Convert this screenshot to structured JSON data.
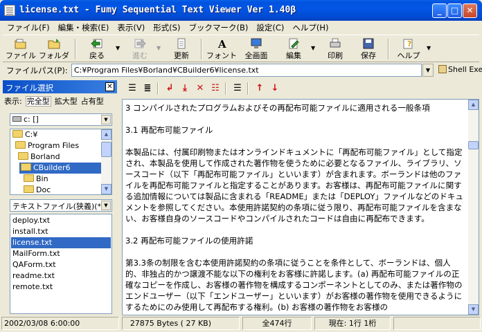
{
  "window": {
    "title": "license.txt - Fumy Sequential Text Viewer  Ver 1.40β",
    "minimize": "_",
    "maximize": "□",
    "close": "✕"
  },
  "menu": [
    "ファイル(F)",
    "編集・検索(E)",
    "表示(V)",
    "形式(S)",
    "ブックマーク(B)",
    "設定(C)",
    "ヘルプ(H)"
  ],
  "toolbar": {
    "file": "ファイル",
    "folder": "フォルダ",
    "back": "戻る",
    "forward": "進む",
    "refresh": "更新",
    "font": "フォント",
    "fullscreen": "全画面",
    "edit": "編集",
    "print": "印刷",
    "save": "保存",
    "help": "ヘルプ"
  },
  "pathbar": {
    "label": "ファイルパス(P):",
    "value": "C:¥Program Files¥Borland¥CBuilder6¥license.txt",
    "shell_button": "Shell Exec."
  },
  "left_panel": {
    "title": "ファイル選択",
    "view_label": "表示:",
    "view_options": [
      "完全型",
      "拡大型",
      "占有型"
    ],
    "drive": "c: []",
    "tree": [
      {
        "label": "C:¥",
        "selected": false
      },
      {
        "label": "Program Files",
        "selected": false
      },
      {
        "label": "Borland",
        "selected": false
      },
      {
        "label": "CBuilder6",
        "selected": true
      },
      {
        "label": "Bin",
        "selected": false
      },
      {
        "label": "Doc",
        "selected": false
      }
    ],
    "filter": "テキストファイル(狭義)(*",
    "files": [
      {
        "name": "deploy.txt",
        "selected": false
      },
      {
        "name": "install.txt",
        "selected": false
      },
      {
        "name": "license.txt",
        "selected": true
      },
      {
        "name": "MailForm.txt",
        "selected": false
      },
      {
        "name": "QAForm.txt",
        "selected": false
      },
      {
        "name": "readme.txt",
        "selected": false
      },
      {
        "name": "remote.txt",
        "selected": false
      }
    ]
  },
  "document": {
    "lines": [
      "3 コンパイルされたプログラムおよびその再配布可能ファイルに適用される一般条項",
      "",
      "3.1 再配布可能ファイル",
      "",
      "本製品には、付属印刷物またはオンラインドキュメントに「再配布可能ファイル」として指定され、本製品を使用して作成された著作物を使うために必要となるファイル、ライブラリ、ソースコード（以下「再配布可能ファイル」といいます）が含まれます。ボーランドは他のファイルを再配布可能ファイルと指定することがあります。お客様は、再配布可能ファイルに関する追加情報については製品に含まれる「README」または「DEPLOY」ファイルなどのドキュメントを参照してください。本使用許諾契約の条項に従う限り、再配布可能ファイルを含まない、お客様自身のソースコードやコンパイルされたコードは自由に再配布できます。",
      "",
      "3.2 再配布可能ファイルの使用許諾",
      "",
      "第3.3条の制限を含む本使用許諾契約の条項に従うことを条件として、ボーランドは、個人的、非独占的かつ譲渡不能な以下の権利をお客様に許諾します。(a) 再配布可能ファイルの正確なコピーを作成し、お客様の著作物を構成するコンポーネントとしてのみ、または著作物のエンドユーザー（以下「エンドユーザー」といいます）がお客様の著作物を使用できるようにするためにのみ使用して再配布する権利。(b) お客様の著作物をお客様の"
    ]
  },
  "status": {
    "date": "2002/03/08 6:00:00",
    "size": "27875 Bytes ( 27 KB)",
    "total_lines": "全474行",
    "position": "現在: 1行 1桁"
  }
}
